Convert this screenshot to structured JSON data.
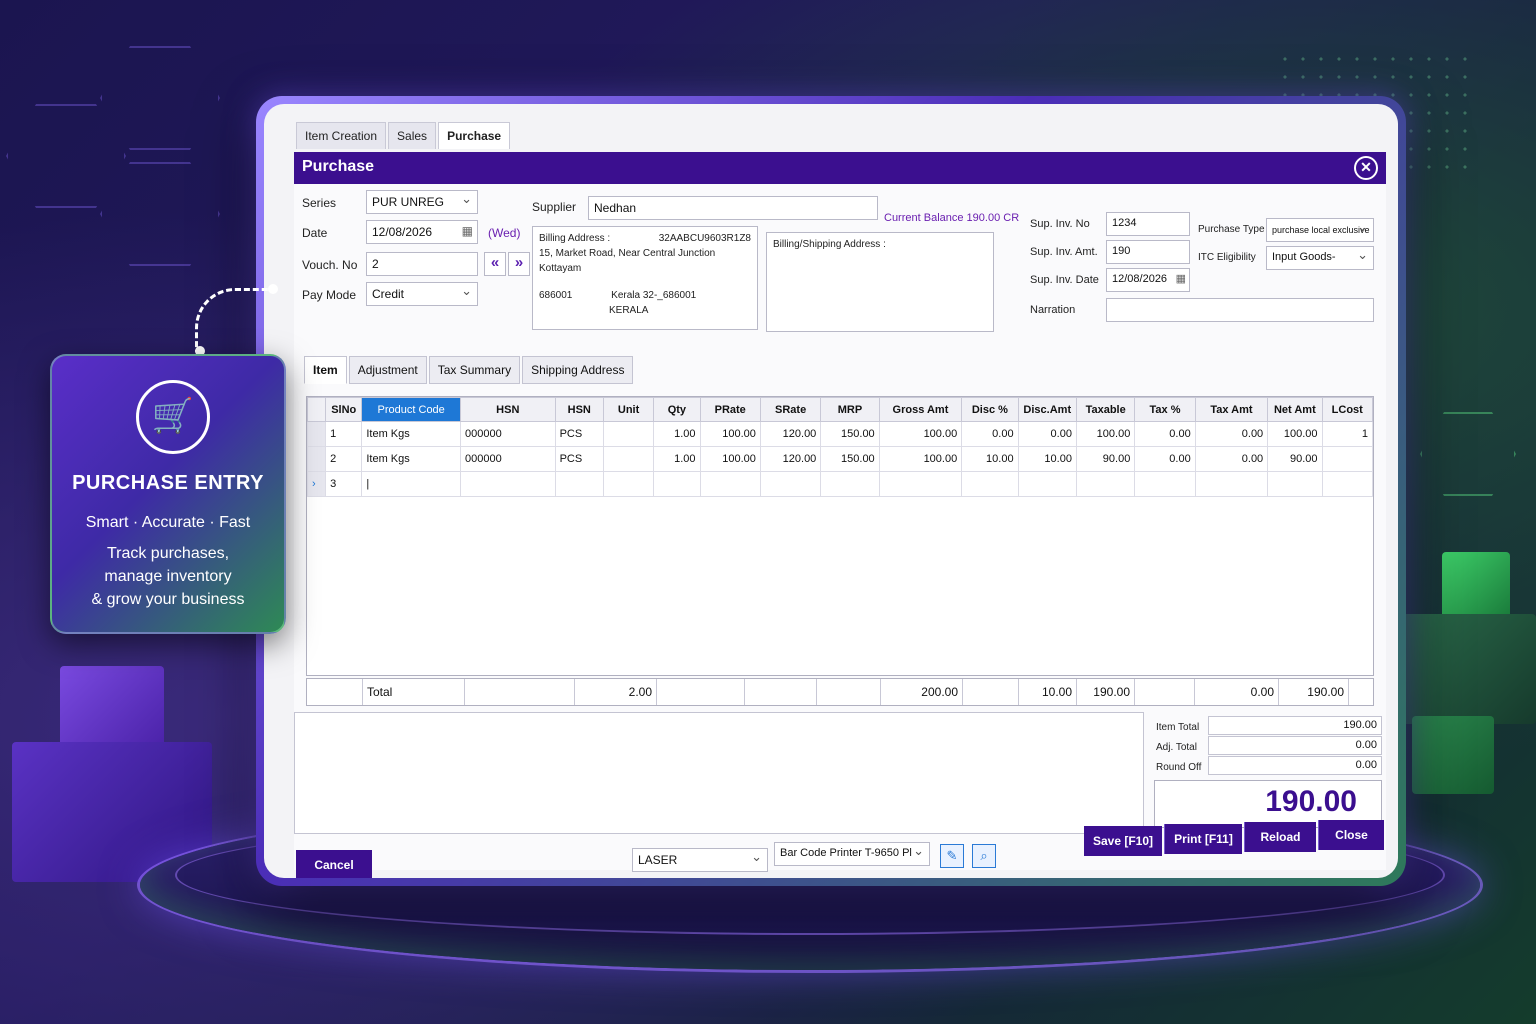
{
  "top_tabs": [
    "Item Creation",
    "Sales",
    "Purchase"
  ],
  "window_title": "Purchase",
  "form": {
    "series_label": "Series",
    "series_value": "PUR UNREG",
    "date_label": "Date",
    "date_value": "12/08/2026",
    "day": "(Wed)",
    "vouch_label": "Vouch. No",
    "vouch_value": "2",
    "paymode_label": "Pay Mode",
    "paymode_value": "Credit",
    "supplier_label": "Supplier",
    "supplier_value": "Nedhan",
    "balance": "Current Balance  190.00  CR",
    "billing_label": "Billing Address :",
    "gstin": "32AABCU9603R1Z8",
    "billing_line1": "15, Market Road, Near Central Junction",
    "billing_line2": "Kottayam",
    "billing_pin": "686001",
    "billing_state": "Kerala 32-_686001",
    "billing_country": "KERALA",
    "shipping_label": "Billing/Shipping Address :",
    "supinv_label": "Sup. Inv. No",
    "supinv_value": "1234",
    "supamt_label": "Sup. Inv. Amt.",
    "supamt_value": "190",
    "supdate_label": "Sup. Inv. Date",
    "supdate_value": "12/08/2026",
    "narration_label": "Narration",
    "ptype_label": "Purchase Type",
    "ptype_value": "purchase local exclusive",
    "itc_label": "ITC Eligibility",
    "itc_value": "Input Goods-"
  },
  "sub_tabs": [
    "Item",
    "Adjustment",
    "Tax Summary",
    "Shipping Address"
  ],
  "table": {
    "headers": [
      "SlNo",
      "Product Code",
      "HSN",
      "HSN",
      "Unit",
      "Qty",
      "PRate",
      "SRate",
      "MRP",
      "Gross Amt",
      "Disc %",
      "Disc.Amt",
      "Taxable",
      "Tax %",
      "Tax Amt",
      "Net Amt",
      "LCost"
    ],
    "rows": [
      [
        "1",
        "Item Kgs",
        "000000",
        "PCS",
        "",
        "1.00",
        "100.00",
        "120.00",
        "150.00",
        "100.00",
        "0.00",
        "0.00",
        "100.00",
        "0.00",
        "0.00",
        "100.00",
        "1"
      ],
      [
        "2",
        "Item Kgs",
        "000000",
        "PCS",
        "",
        "1.00",
        "100.00",
        "120.00",
        "150.00",
        "100.00",
        "10.00",
        "10.00",
        "90.00",
        "0.00",
        "0.00",
        "90.00",
        ""
      ],
      [
        "3",
        "|",
        "",
        "",
        "",
        "",
        "",
        "",
        "",
        "",
        "",
        "",
        "",
        "",
        "",
        "",
        ""
      ]
    ]
  },
  "totals": {
    "label": "Total",
    "qty": "2.00",
    "gross": "200.00",
    "disc": "10.00",
    "taxable": "190.00",
    "tax": "0.00",
    "net": "190.00"
  },
  "summary": {
    "item_total_label": "Item Total",
    "item_total": "190.00",
    "adj_total_label": "Adj. Total",
    "adj_total": "0.00",
    "round_off_label": "Round Off",
    "round_off": "0.00",
    "grand_total": "190.00"
  },
  "footer": {
    "cancel": "Cancel",
    "print_mode": "LASER",
    "printer": "Bar Code Printer T-9650 Pl",
    "save": "Save [F10]",
    "print": "Print [F11]",
    "reload": "Reload",
    "close": "Close"
  },
  "promo": {
    "title": "PURCHASE ENTRY",
    "tagline": "Smart · Accurate · Fast",
    "desc1": "Track purchases,",
    "desc2": "manage inventory",
    "desc3": "& grow your business"
  },
  "colors": {
    "accent": "#3b0f8f",
    "selected_header": "#1e78d6",
    "promo_green": "#2e8a55"
  }
}
